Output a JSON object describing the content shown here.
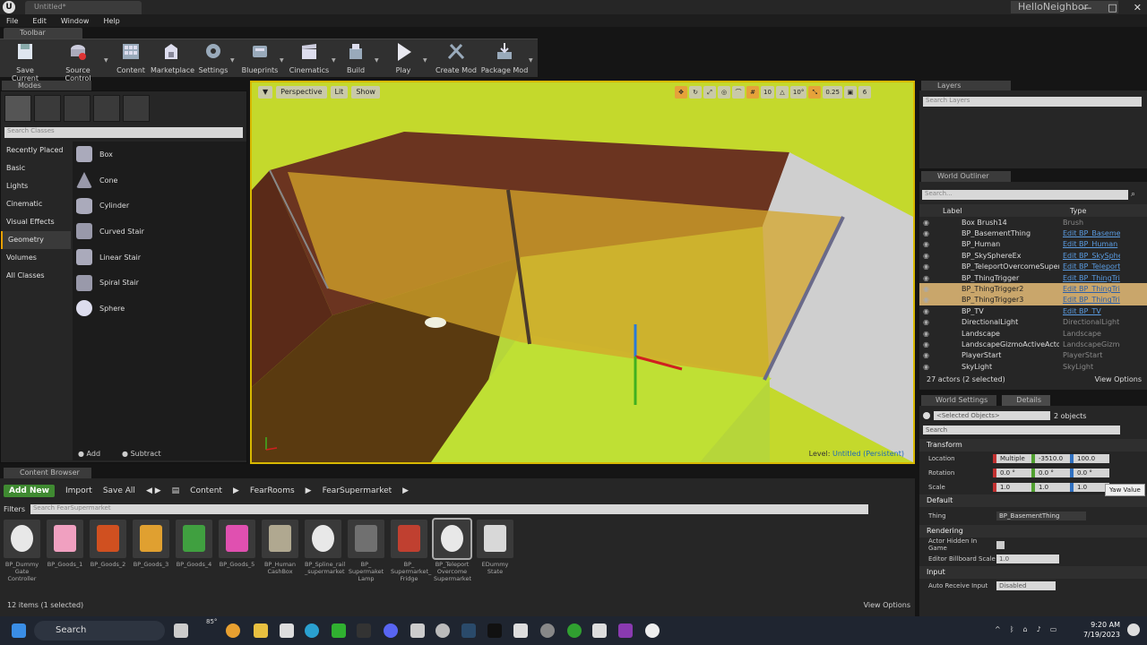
{
  "app": {
    "logo": "U",
    "document_tab": "Untitled*",
    "project": "HelloNeighbor",
    "window_controls": [
      "—",
      "□",
      "✕"
    ]
  },
  "menu": [
    "File",
    "Edit",
    "Window",
    "Help"
  ],
  "toolbar": {
    "tab_label": "Toolbar",
    "buttons": [
      {
        "label": "Save Current",
        "icon": "save-icon"
      },
      {
        "label": "Source Control",
        "icon": "source-control-icon"
      },
      {
        "label": "Content",
        "icon": "content-icon"
      },
      {
        "label": "Marketplace",
        "icon": "marketplace-icon"
      },
      {
        "label": "Settings",
        "icon": "settings-icon"
      },
      {
        "label": "Blueprints",
        "icon": "blueprints-icon"
      },
      {
        "label": "Cinematics",
        "icon": "cinematics-icon"
      },
      {
        "label": "Build",
        "icon": "build-icon"
      },
      {
        "label": "Play",
        "icon": "play-icon"
      },
      {
        "label": "Create Mod",
        "icon": "create-mod-icon"
      },
      {
        "label": "Package Mod",
        "icon": "package-mod-icon"
      }
    ]
  },
  "modes": {
    "tab_label": "Modes",
    "search_placeholder": "Search Classes",
    "categories": [
      "Recently Placed",
      "Basic",
      "Lights",
      "Cinematic",
      "Visual Effects",
      "Geometry",
      "Volumes",
      "All Classes"
    ],
    "active_category": "Geometry",
    "items": [
      "Box",
      "Cone",
      "Cylinder",
      "Curved Stair",
      "Linear Stair",
      "Spiral Stair",
      "Sphere"
    ],
    "add_label": "Add",
    "subtract_label": "Subtract"
  },
  "viewport": {
    "perspective": "Perspective",
    "lit": "Lit",
    "show": "Show",
    "grid_snap": "10",
    "rotation_snap": "10°",
    "scale_snap": "0.25",
    "camera_speed": "6",
    "level_prefix": "Level:",
    "level_name": "Untitled (Persistent)"
  },
  "layers": {
    "tab_label": "Layers",
    "search_placeholder": "Search Layers"
  },
  "outliner": {
    "tab_label": "World Outliner",
    "search_placeholder": "Search...",
    "col_label": "Label",
    "col_type": "Type",
    "rows": [
      {
        "label": "Box Brush14",
        "type": "Brush",
        "link": false,
        "selected": false
      },
      {
        "label": "BP_BasementThing",
        "type": "Edit BP_Baseme",
        "link": true,
        "selected": false
      },
      {
        "label": "BP_Human",
        "type": "Edit BP_Human",
        "link": true,
        "selected": false
      },
      {
        "label": "BP_SkySphereEx",
        "type": "Edit BP_SkySphe",
        "link": true,
        "selected": false
      },
      {
        "label": "BP_TeleportOvercomeSupermarket",
        "type": "Edit BP_Teleport",
        "link": true,
        "selected": false
      },
      {
        "label": "BP_ThingTrigger",
        "type": "Edit BP_ThingTri",
        "link": true,
        "selected": false
      },
      {
        "label": "BP_ThingTrigger2",
        "type": "Edit BP_ThingTri",
        "link": true,
        "selected": true
      },
      {
        "label": "BP_ThingTrigger3",
        "type": "Edit BP_ThingTri",
        "link": true,
        "selected": true
      },
      {
        "label": "BP_TV",
        "type": "Edit BP_TV",
        "link": true,
        "selected": false
      },
      {
        "label": "DirectionalLight",
        "type": "DirectionalLight",
        "link": false,
        "selected": false
      },
      {
        "label": "Landscape",
        "type": "Landscape",
        "link": false,
        "selected": false
      },
      {
        "label": "LandscapeGizmoActiveActor",
        "type": "LandscapeGizmo",
        "link": false,
        "selected": false
      },
      {
        "label": "PlayerStart",
        "type": "PlayerStart",
        "link": false,
        "selected": false
      },
      {
        "label": "SkyLight",
        "type": "SkyLight",
        "link": false,
        "selected": false
      }
    ],
    "footer_count": "27 actors (2 selected)",
    "view_options": "View Options"
  },
  "details": {
    "tab_world_settings": "World Settings",
    "tab_details": "Details",
    "selected_objects": "<Selected Objects>",
    "objects_count": "2 objects",
    "search_placeholder": "Search",
    "transform_section": "Transform",
    "location_label": "Location",
    "location": [
      "Multiple",
      "-3510.0",
      "100.0"
    ],
    "rotation_label": "Rotation",
    "rotation": [
      "0.0 °",
      "0.0 °",
      "0.0 °"
    ],
    "scale_label": "Scale",
    "scale": [
      "1.0",
      "1.0",
      "1.0"
    ],
    "tooltip": "Yaw Value",
    "default_section": "Default",
    "thing_label": "Thing",
    "thing_value": "BP_BasementThing",
    "rendering_section": "Rendering",
    "actor_hidden_label": "Actor Hidden In Game",
    "billboard_label": "Editor Billboard Scale",
    "billboard_value": "1.0",
    "input_section": "Input",
    "auto_receive_label": "Auto Receive Input",
    "auto_receive_value": "Disabled"
  },
  "content_browser": {
    "tab_label": "Content Browser",
    "add_new": "Add New",
    "import": "Import",
    "save_all": "Save All",
    "path": [
      "Content",
      "FearRooms",
      "FearSupermarket"
    ],
    "filters": "Filters",
    "search_placeholder": "Search FearSupermarket",
    "assets": [
      {
        "name": "BP_Dummy Gate Controller",
        "color": "#e8e8e8",
        "selected": false
      },
      {
        "name": "BP_Goods_1",
        "color": "#f0a0c0",
        "selected": false
      },
      {
        "name": "BP_Goods_2",
        "color": "#d05020",
        "selected": false
      },
      {
        "name": "BP_Goods_3",
        "color": "#e0a030",
        "selected": false
      },
      {
        "name": "BP_Goods_4",
        "color": "#40a040",
        "selected": false
      },
      {
        "name": "BP_Goods_5",
        "color": "#e050b0",
        "selected": false
      },
      {
        "name": "BP_Human CashBox",
        "color": "#b0a890",
        "selected": false
      },
      {
        "name": "BP_Spline_rail _supermarket",
        "color": "#e8e8e8",
        "selected": false
      },
      {
        "name": "BP_ Supermaket Lamp",
        "color": "#707070",
        "selected": false
      },
      {
        "name": "BP_ Supermarket_ Fridge",
        "color": "#c04030",
        "selected": false
      },
      {
        "name": "BP_Teleport Overcome Supermarket",
        "color": "#e8e8e8",
        "selected": true
      },
      {
        "name": "EDummy State",
        "color": "#d8d8d8",
        "selected": false
      }
    ],
    "footer_count": "12 items (1 selected)",
    "view_options": "View Options"
  },
  "taskbar": {
    "search": "Search",
    "weather": "85°",
    "time": "9:20 AM",
    "date": "7/19/2023"
  }
}
